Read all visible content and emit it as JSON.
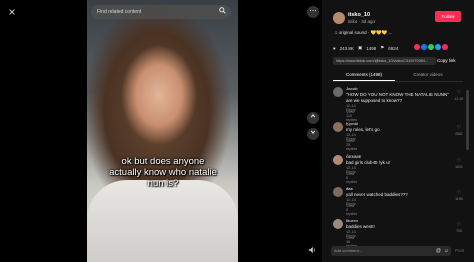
{
  "player": {
    "close_icon": "×",
    "search_placeholder": "Find related content",
    "caption": "ok but does anyone actually know who natalie nun is?"
  },
  "author": {
    "username": "itsko_10",
    "meta": "itsko · 3d ago",
    "follow_label": "Follow"
  },
  "sound": "♫ original sound · 💛💛💛 ...",
  "stats": {
    "likes": "243.8K",
    "comments": "1498",
    "saves": "6924"
  },
  "share_colors": [
    "#fe2c55",
    "#1877f2",
    "#25d366",
    "#1da1f2",
    "#fe2c55"
  ],
  "url": "https://www.tiktok.com/@itsko_10/video/7312970954...",
  "copy_link_label": "Copy link",
  "tabs": {
    "comments": "Comments (1498)",
    "creator": "Creator videos"
  },
  "comments": [
    {
      "name": "Jacob",
      "text": "\"HOW DO YOU NOT KNOW THE NATALIE NUNN\" are we supposed to know??",
      "meta": "12-14  Reply",
      "replies": "View 110 replies ⌄",
      "likes": "12.1K"
    },
    {
      "name": "Kymbi",
      "text": "my rules, let's go",
      "meta": "12-14  Reply",
      "replies": "View 25 replies ⌄",
      "likes": "2561"
    },
    {
      "name": "GENNIE",
      "text": "bad girls club👄 lyk ur",
      "meta": "12-14  Reply",
      "replies": "View 6 replies ⌄",
      "likes": "1021"
    },
    {
      "name": "aaa",
      "text": "yall never watched baddies???",
      "meta": "12-14  Reply",
      "replies": "View 8 replies ⌄",
      "likes": "1190"
    },
    {
      "name": "lauren",
      "text": "baddies west!!",
      "meta": "12-14  Reply",
      "replies": "View 16 replies ⌄",
      "likes": "700"
    }
  ],
  "input": {
    "placeholder": "Add comment...",
    "at_icon": "@",
    "emoji_icon": "☺",
    "post_label": "Post"
  }
}
